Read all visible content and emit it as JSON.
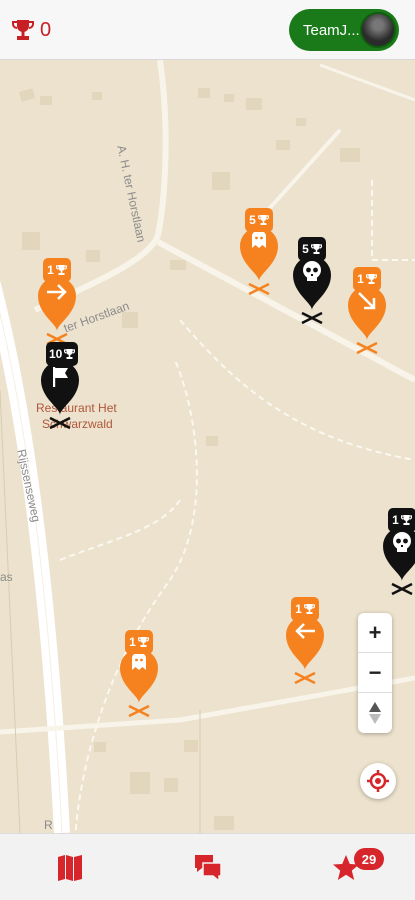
{
  "header": {
    "trophy_count": "0",
    "team_name": "TeamJ..."
  },
  "map": {
    "street_labels": {
      "horstlaan_vertical": "A. H. ter Horstlaan",
      "horstlaan_diagonal": "ter Horstlaan",
      "rijssenseweg": "Rijssenseweg",
      "left_edge": "as",
      "bottom_edge": "R"
    },
    "poi": {
      "line1": "Restaurant Het",
      "line2": "Schwarzwald"
    },
    "markers": [
      {
        "id": "ghost-1",
        "style": "orange",
        "icon": "ghost-icon",
        "points": "5"
      },
      {
        "id": "skull-1",
        "style": "black",
        "icon": "skull-icon",
        "points": "5"
      },
      {
        "id": "arrow-right",
        "style": "orange",
        "icon": "arrow-right-icon",
        "points": "1"
      },
      {
        "id": "flag",
        "style": "black",
        "icon": "flag-icon",
        "points": "10"
      },
      {
        "id": "arrow-down-right",
        "style": "orange",
        "icon": "arrow-down-right-icon",
        "points": "1"
      },
      {
        "id": "skull-2",
        "style": "black",
        "icon": "skull-icon",
        "points": "1"
      },
      {
        "id": "arrow-left",
        "style": "orange",
        "icon": "arrow-left-icon",
        "points": "1"
      },
      {
        "id": "ghost-2",
        "style": "orange",
        "icon": "ghost-icon",
        "points": "1"
      }
    ],
    "zoom": {
      "in_label": "+",
      "out_label": "−"
    }
  },
  "bottom_nav": {
    "items": [
      "map-icon",
      "chat-icon",
      "star-icon"
    ],
    "notification_count": "29"
  },
  "colors": {
    "accent_red": "#c81f24",
    "team_green": "#1a7a1a",
    "marker_orange": "#f5821f",
    "marker_black": "#111111",
    "map_bg": "#ece2cd"
  }
}
